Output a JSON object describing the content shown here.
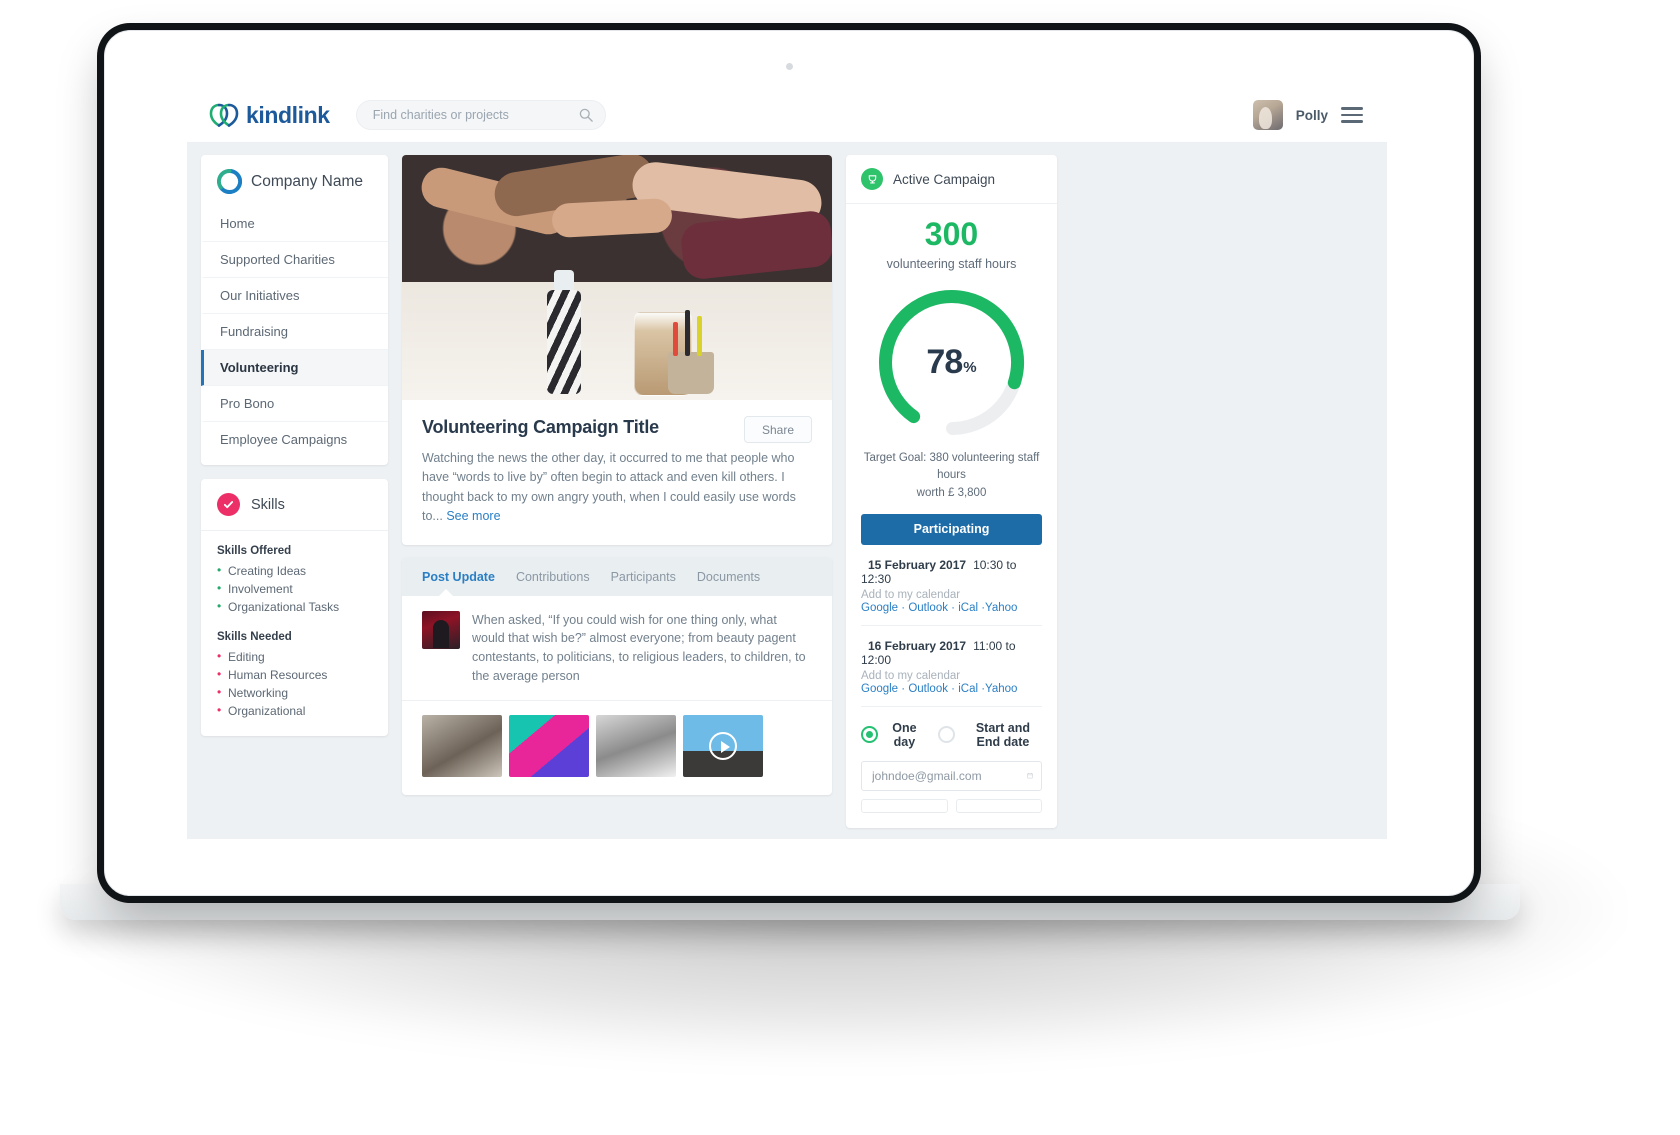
{
  "brand": {
    "name": "kindlink",
    "logo_icon": "kindlink-logo-icon"
  },
  "search": {
    "placeholder": "Find charities or projects",
    "value": "",
    "icon": "search-icon"
  },
  "header": {
    "user_name": "Polly",
    "avatar_icon": "user-avatar",
    "menu_icon": "hamburger-menu-icon"
  },
  "sidebar": {
    "company_name": "Company Name",
    "company_logo_icon": "company-logo-icon",
    "items": [
      {
        "label": "Home",
        "active": false
      },
      {
        "label": "Supported Charities",
        "active": false
      },
      {
        "label": "Our Initiatives",
        "active": false
      },
      {
        "label": "Fundraising",
        "active": false
      },
      {
        "label": "Volunteering",
        "active": true
      },
      {
        "label": "Pro Bono",
        "active": false
      },
      {
        "label": "Employee Campaigns",
        "active": false
      }
    ]
  },
  "skills": {
    "title": "Skills",
    "badge_icon": "check-circle-icon",
    "offered_heading": "Skills Offered",
    "offered": [
      "Creating Ideas",
      "Involvement",
      "Organizational Tasks"
    ],
    "needed_heading": "Skills Needed",
    "needed": [
      "Editing",
      "Human Resources",
      "Networking",
      "Organizational"
    ]
  },
  "post": {
    "title": "Volunteering Campaign Title",
    "share_label": "Share",
    "body": "Watching the news the other day, it occurred to me that people who have “words to live by” often begin to attack and even kill others. I thought back to my own angry youth, when I could easily use words to...",
    "see_more": "See more"
  },
  "tabs": [
    {
      "label": "Post Update",
      "active": true
    },
    {
      "label": "Contributions",
      "active": false
    },
    {
      "label": "Participants",
      "active": false
    },
    {
      "label": "Documents",
      "active": false
    }
  ],
  "update": {
    "thumb_icon": "post-author-thumbnail",
    "text": "When asked, “If you could wish for one thing only, what would that wish be?” almost everyone; from beauty pagent contestants, to politicians, to religious leaders, to children, to the average person",
    "media": [
      {
        "name": "media-thumbnail-1",
        "type": "image"
      },
      {
        "name": "media-thumbnail-2",
        "type": "image"
      },
      {
        "name": "media-thumbnail-3",
        "type": "image"
      },
      {
        "name": "media-thumbnail-4",
        "type": "video",
        "play_icon": "play-icon"
      }
    ]
  },
  "campaign": {
    "header_title": "Active Campaign",
    "header_icon": "campaign-trophy-icon",
    "hours_value": "300",
    "hours_label": "volunteering staff hours",
    "progress_value": "78",
    "progress_unit": "%",
    "progress_percent": 78,
    "goal_line1": "Target Goal: 380 volunteering staff hours",
    "goal_line2": "worth £ 3,800",
    "cta_label": "Participating",
    "accent_green": "#1db863",
    "accent_blue": "#1d6ca8",
    "track_gray": "#eceef0",
    "schedule": [
      {
        "date": "15 February 2017",
        "time": "10:30 to 12:30",
        "add_label": "Add to my calendar",
        "links": [
          "Google",
          "Outlook",
          "iCal",
          "Yahoo"
        ]
      },
      {
        "date": "16 February 2017",
        "time": "11:00 to 12:00",
        "add_label": "Add to my calendar",
        "links": [
          "Google",
          "Outlook",
          "iCal",
          "Yahoo"
        ]
      }
    ],
    "date_mode": {
      "one_day_label": "One day",
      "one_day_selected": true,
      "range_label": "Start and End date",
      "range_selected": false
    },
    "email_input": {
      "value": "johndoe@gmail.com",
      "placeholder": "johndoe@gmail.com",
      "icon": "calendar-icon"
    }
  }
}
